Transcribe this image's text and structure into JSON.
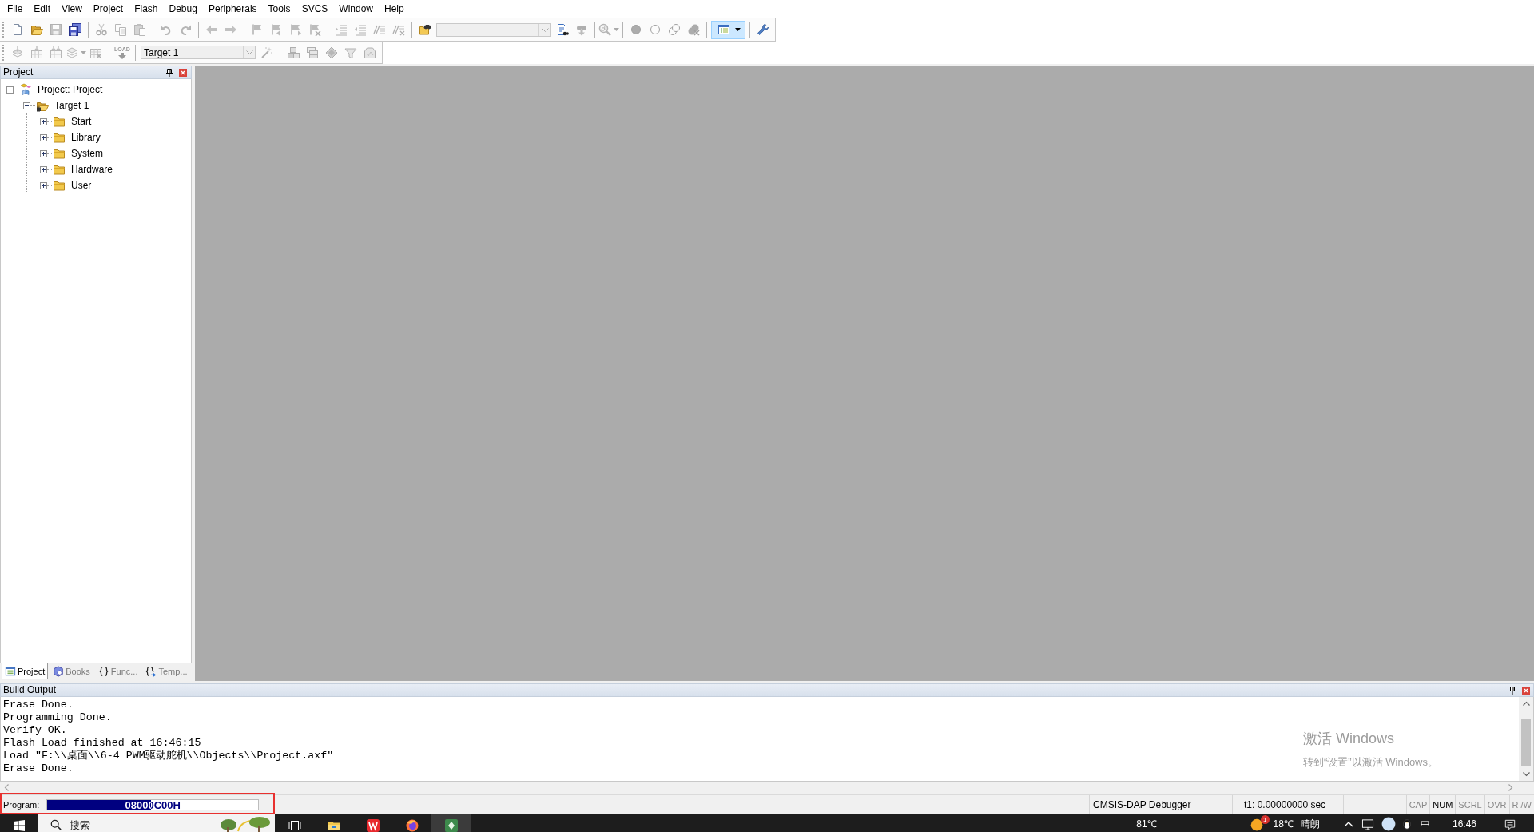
{
  "menu_bar": [
    "File",
    "Edit",
    "View",
    "Project",
    "Flash",
    "Debug",
    "Peripherals",
    "Tools",
    "SVCS",
    "Window",
    "Help"
  ],
  "toolbars": [
    {
      "groups": [
        [
          {
            "kind": "new",
            "disabled": false
          },
          {
            "kind": "open",
            "disabled": false
          },
          {
            "kind": "save",
            "disabled": true
          },
          {
            "kind": "saveall",
            "disabled": false
          }
        ],
        [
          {
            "kind": "cut",
            "disabled": true
          },
          {
            "kind": "copy",
            "disabled": true
          },
          {
            "kind": "paste",
            "disabled": true
          }
        ],
        [
          {
            "kind": "undo",
            "disabled": true
          },
          {
            "kind": "redo",
            "disabled": true
          }
        ],
        [
          {
            "kind": "back",
            "disabled": true
          },
          {
            "kind": "forward",
            "disabled": true
          }
        ],
        [
          {
            "kind": "bookmark",
            "disabled": true
          },
          {
            "kind": "bookmarkprev",
            "disabled": true
          },
          {
            "kind": "bookmarknext",
            "disabled": true
          },
          {
            "kind": "bookmarkclear",
            "disabled": true
          }
        ],
        [
          {
            "kind": "indent",
            "disabled": true
          },
          {
            "kind": "unindent",
            "disabled": true
          },
          {
            "kind": "comment",
            "disabled": true
          },
          {
            "kind": "uncomment",
            "disabled": true
          }
        ],
        [
          {
            "kind": "findfiles",
            "disabled": false
          },
          {
            "kind": "combo",
            "disabled": true
          },
          {
            "kind": "finddoc",
            "disabled": false
          },
          {
            "kind": "findnext",
            "disabled": true
          }
        ],
        [
          {
            "kind": "debug",
            "disabled": true,
            "dropdown": true
          }
        ],
        [
          {
            "kind": "breakpoint",
            "disabled": true
          },
          {
            "kind": "breakpointoff",
            "disabled": true
          },
          {
            "kind": "breakpoints",
            "disabled": true
          },
          {
            "kind": "breakpointsclear",
            "disabled": true
          }
        ],
        [
          {
            "kind": "windows",
            "disabled": false,
            "dropdown": true,
            "pressed": true
          }
        ],
        [
          {
            "kind": "config",
            "disabled": false
          }
        ]
      ]
    },
    {
      "groups": [
        [
          {
            "kind": "translate",
            "disabled": true
          },
          {
            "kind": "build",
            "disabled": true
          },
          {
            "kind": "rebuild",
            "disabled": true
          },
          {
            "kind": "batch",
            "disabled": true,
            "dropdown": true
          },
          {
            "kind": "stop",
            "disabled": true
          }
        ],
        [
          {
            "kind": "load",
            "label": "LOAD",
            "disabled": true
          }
        ],
        [
          {
            "kind": "combo",
            "value": "Target 1",
            "disabled": true
          },
          {
            "kind": "wand",
            "disabled": true
          }
        ],
        [
          {
            "kind": "items",
            "disabled": true
          },
          {
            "kind": "multiproject",
            "disabled": true
          },
          {
            "kind": "components",
            "disabled": true
          },
          {
            "kind": "packs",
            "disabled": true
          },
          {
            "kind": "installer",
            "disabled": true
          }
        ]
      ]
    }
  ],
  "project_panel": {
    "title": "Project",
    "tree": [
      {
        "label": "Project: Project",
        "kind": "project",
        "expanded": true,
        "children": [
          {
            "label": "Target 1",
            "kind": "target",
            "expanded": true,
            "children": [
              {
                "label": "Start",
                "kind": "group",
                "expanded": false
              },
              {
                "label": "Library",
                "kind": "group",
                "expanded": false
              },
              {
                "label": "System",
                "kind": "group",
                "expanded": false
              },
              {
                "label": "Hardware",
                "kind": "group",
                "expanded": false
              },
              {
                "label": "User",
                "kind": "group",
                "expanded": false
              }
            ]
          }
        ]
      }
    ],
    "tabs": [
      {
        "label": "Project",
        "kind": "project",
        "selected": true
      },
      {
        "label": "Books",
        "kind": "books",
        "selected": false
      },
      {
        "label": "Func...",
        "kind": "functions",
        "selected": false
      },
      {
        "label": "Temp...",
        "kind": "templates",
        "selected": false
      }
    ]
  },
  "build_output": {
    "title": "Build Output",
    "lines": [
      "Erase Done.",
      "Programming Done.",
      "Verify OK.",
      "Flash Load finished at 16:46:15",
      "Load \"F:\\\\桌面\\\\6-4 PWM驱动舵机\\\\Objects\\\\Project.axf\"",
      "Erase Done."
    ]
  },
  "activation_notice": {
    "title": "激活 Windows",
    "text": "转到“设置”以激活 Windows。"
  },
  "status_bar": {
    "program": {
      "label": "Program:",
      "value": "08000C00H",
      "level": 0.49,
      "highlighted": true
    },
    "debugger": "CMSIS-DAP Debugger",
    "timer": "t1: 0.00000000 sec",
    "indicators": [
      {
        "label": "CAP",
        "on": false
      },
      {
        "label": "NUM",
        "on": true
      },
      {
        "label": "SCRL",
        "on": false
      },
      {
        "label": "OVR",
        "on": false
      },
      {
        "label": "R /W",
        "on": false
      }
    ]
  },
  "taskbar": {
    "search": {
      "placeholder": "搜索"
    },
    "apps": [
      {
        "kind": "taskview",
        "active": false
      },
      {
        "kind": "explorer",
        "active": false
      },
      {
        "kind": "wps",
        "active": false
      },
      {
        "kind": "browser",
        "active": false
      },
      {
        "kind": "ide",
        "active": true
      }
    ],
    "cpu_temperature": "81℃",
    "weather": {
      "temperature": "18℃",
      "condition": "晴朗",
      "badge": "1"
    },
    "input_method": "中",
    "clock": "16:46"
  }
}
